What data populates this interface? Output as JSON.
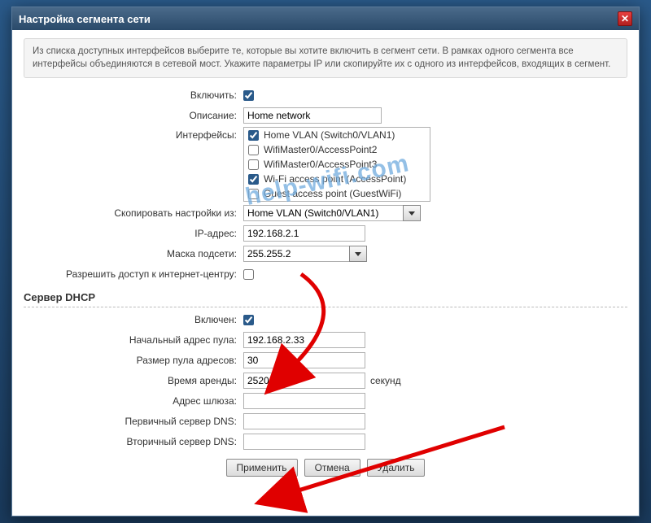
{
  "dialog": {
    "title": "Настройка сегмента сети",
    "info": "Из списка доступных интерфейсов выберите те, которые вы хотите включить в сегмент сети. В рамках одного сегмента все интерфейсы объединяются в сетевой мост. Укажите параметры IP или скопируйте их с одного из интерфейсов, входящих в сегмент."
  },
  "labels": {
    "enable": "Включить:",
    "description": "Описание:",
    "interfaces": "Интерфейсы:",
    "copy_from": "Скопировать настройки из:",
    "ip": "IP-адрес:",
    "mask": "Маска подсети:",
    "allow_admin": "Разрешить доступ к интернет-центру:",
    "dhcp_section": "Сервер DHCP",
    "dhcp_enable": "Включен:",
    "pool_start": "Начальный адрес пула:",
    "pool_size": "Размер пула адресов:",
    "lease": "Время аренды:",
    "gateway": "Адрес шлюза:",
    "dns1": "Первичный сервер DNS:",
    "dns2": "Вторичный сервер DNS:",
    "seconds": "секунд"
  },
  "values": {
    "enable": true,
    "description": "Home network",
    "copy_from": "Home VLAN (Switch0/VLAN1)",
    "ip": "192.168.2.1",
    "mask": "255.255.2",
    "allow_admin": false,
    "dhcp_enable": true,
    "pool_start": "192.168.2.33",
    "pool_size": "30",
    "lease": "25200",
    "gateway": "",
    "dns1": "",
    "dns2": ""
  },
  "interfaces": [
    {
      "label": "Home VLAN (Switch0/VLAN1)",
      "checked": true
    },
    {
      "label": "WifiMaster0/AccessPoint2",
      "checked": false
    },
    {
      "label": "WifiMaster0/AccessPoint3",
      "checked": false
    },
    {
      "label": "Wi-Fi access point (AccessPoint)",
      "checked": true
    },
    {
      "label": "Guest access point (GuestWiFi)",
      "checked": false
    }
  ],
  "buttons": {
    "apply": "Применить",
    "cancel": "Отмена",
    "delete": "Удалить"
  },
  "watermark": "help-wifi.com"
}
